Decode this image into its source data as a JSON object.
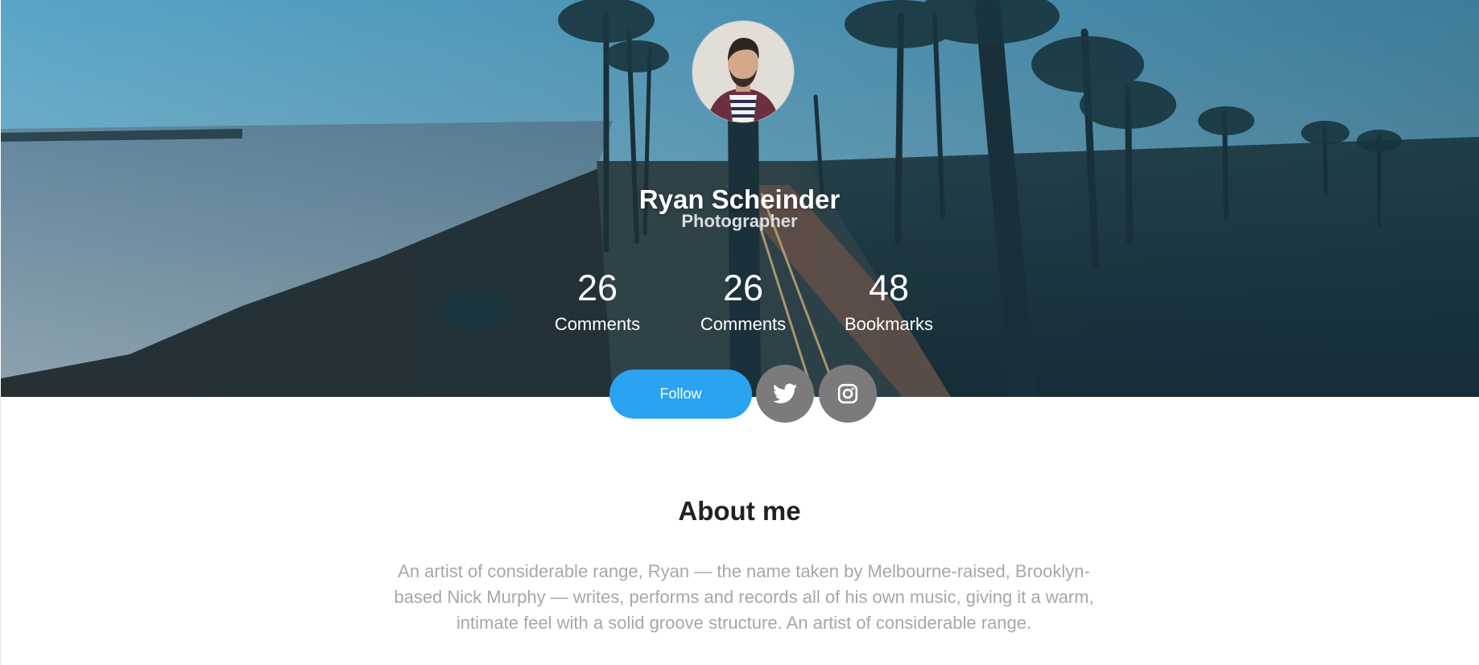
{
  "profile": {
    "name": "Ryan Scheinder",
    "role": "Photographer"
  },
  "stats": [
    {
      "value": "26",
      "label": "Comments"
    },
    {
      "value": "26",
      "label": "Comments"
    },
    {
      "value": "48",
      "label": "Bookmarks"
    }
  ],
  "actions": {
    "follow_label": "Follow",
    "twitter_icon": "twitter-icon",
    "instagram_icon": "instagram-icon"
  },
  "about": {
    "title": "About me",
    "text": "An artist of considerable range, Ryan — the name taken by Melbourne-raised, Brooklyn-based Nick Murphy — writes, performs and records all of his own music, giving it a warm, intimate feel with a solid groove structure. An artist of considerable range."
  },
  "colors": {
    "accent": "#2aa3f0",
    "social_button": "#7b7b7b",
    "heading": "#222222",
    "body_text": "#a7a7a7"
  }
}
